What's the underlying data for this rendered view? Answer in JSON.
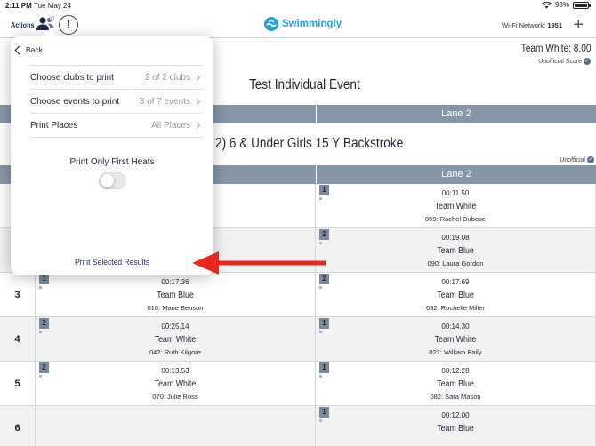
{
  "status_bar": {
    "time": "2:11 PM",
    "date": "Tue May 24",
    "battery": "93%"
  },
  "nav": {
    "actions_label": "Actions",
    "logo_text": "Swimmingly",
    "wifi_label": "Wi-Fi Network:",
    "wifi_value": "1951",
    "add_icon": "plus-icon",
    "alert_icon": "!"
  },
  "score": {
    "team_score": "Team White: 8.00",
    "status": "Unofficial Score"
  },
  "event": {
    "title": "Test Individual Event",
    "heat_title": "2) 6 & Under Girls 15 Y Backstroke",
    "status": "Unofficial"
  },
  "lane_headers": {
    "lane2_top": "Lane 2",
    "lane2_heat": "Lane 2"
  },
  "popover": {
    "back_label": "Back",
    "items": [
      {
        "label": "Choose clubs to print",
        "value": "2 of 2 clubs"
      },
      {
        "label": "Choose events to print",
        "value": "3 of 7 events"
      },
      {
        "label": "Print Places",
        "value": "All Places"
      }
    ],
    "toggle_label": "Print Only First Heats",
    "toggle_on": false,
    "print_button": "Print Selected Results"
  },
  "rows": [
    {
      "lane": "",
      "c1": null,
      "c2": {
        "place": "1",
        "time": "00:11.50",
        "team": "Team White",
        "swimmer": "059: Rachel Dubose"
      }
    },
    {
      "lane": "",
      "c1": null,
      "c2": {
        "place": "2",
        "time": "00:19.08",
        "team": "Team Blue",
        "swimmer": "090: Laura Gordon"
      }
    },
    {
      "lane": "3",
      "c1": {
        "place": "1",
        "time": "00:17.36",
        "team": "Team Blue",
        "swimmer": "010: Marie Benson"
      },
      "c2": {
        "place": "2",
        "time": "00:17.69",
        "team": "Team Blue",
        "swimmer": "032: Rochelle Miller"
      }
    },
    {
      "lane": "4",
      "c1": {
        "place": "2",
        "time": "00:25.14",
        "team": "Team White",
        "swimmer": "042: Ruth Kilgore"
      },
      "c2": {
        "place": "1",
        "time": "00:14.30",
        "team": "Team White",
        "swimmer": "021: William Baily"
      }
    },
    {
      "lane": "5",
      "c1": {
        "place": "2",
        "time": "00:13.53",
        "team": "Team White",
        "swimmer": "070: Julie Ross"
      },
      "c2": {
        "place": "1",
        "time": "00:12.28",
        "team": "Team Blue",
        "swimmer": "082: Sara Mason"
      }
    },
    {
      "lane": "6",
      "c1": null,
      "c2": {
        "place": "1",
        "time": "00:12.00",
        "team": "Team Blue",
        "swimmer": ""
      }
    }
  ],
  "colors": {
    "header_bar": "#8596a8",
    "brand": "#29a3d6",
    "annotation_arrow": "#e8281e"
  }
}
